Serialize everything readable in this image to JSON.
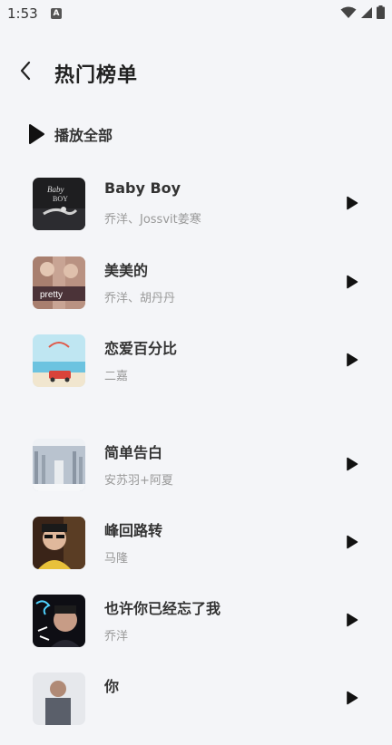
{
  "status_bar": {
    "time": "1:53",
    "notification_letter": "A"
  },
  "header": {
    "title": "热门榜单",
    "back_icon": "chevron-left-icon"
  },
  "play_all": {
    "label": "播放全部",
    "icon": "play-icon"
  },
  "songs": [
    {
      "title": "Baby Boy",
      "artist": "乔洋、Jossvit姜寒"
    },
    {
      "title": "美美的",
      "artist": "乔洋、胡丹丹"
    },
    {
      "title": "恋爱百分比",
      "artist": "二嘉"
    },
    {
      "title": "简单告白",
      "artist": "安苏羽+阿夏"
    },
    {
      "title": "峰回路转",
      "artist": "马隆"
    },
    {
      "title": "也许你已经忘了我",
      "artist": "乔洋"
    },
    {
      "title": "你",
      "artist": ""
    }
  ],
  "colors": {
    "background": "#f4f5f8",
    "title_text": "#333333",
    "artist_text": "#999999",
    "icon": "#111111"
  }
}
